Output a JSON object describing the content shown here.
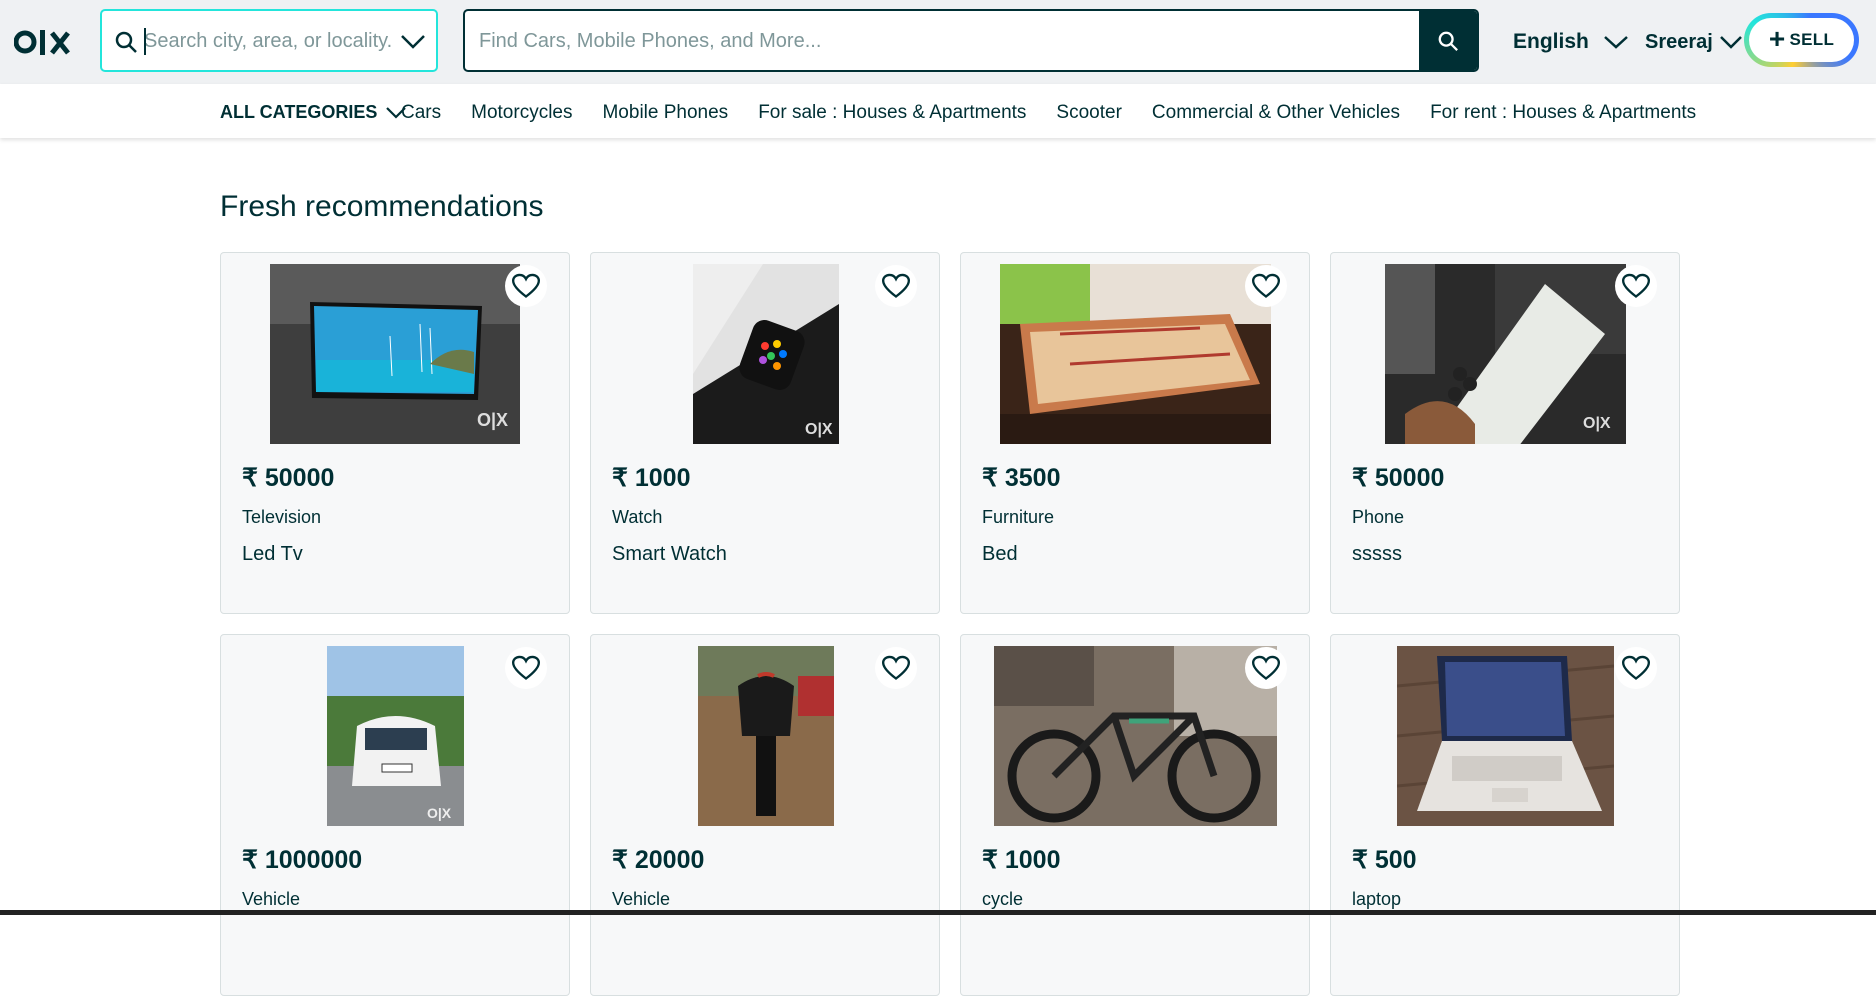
{
  "header": {
    "logo_text": "olx",
    "location_placeholder": "Search city, area, or locality...",
    "search_placeholder": "Find Cars, Mobile Phones, and More...",
    "language": "English",
    "user_name": "Sreeraj",
    "sell_label": "SELL"
  },
  "categories": {
    "all_label": "ALL CATEGORIES",
    "links": [
      "Cars",
      "Motorcycles",
      "Mobile Phones",
      "For sale : Houses & Apartments",
      "Scooter",
      "Commercial & Other Vehicles",
      "For rent : Houses & Apartments"
    ]
  },
  "section": {
    "title": "Fresh recommendations"
  },
  "listings": [
    {
      "price": "₹ 50000",
      "category": "Television",
      "title": "Led Tv"
    },
    {
      "price": "₹ 1000",
      "category": "Watch",
      "title": "Smart Watch"
    },
    {
      "price": "₹ 3500",
      "category": "Furniture",
      "title": "Bed"
    },
    {
      "price": "₹ 50000",
      "category": "Phone",
      "title": "sssss"
    },
    {
      "price": "₹ 1000000",
      "category": "Vehicle",
      "title": ""
    },
    {
      "price": "₹ 20000",
      "category": "Vehicle",
      "title": ""
    },
    {
      "price": "₹ 1000",
      "category": "cycle",
      "title": ""
    },
    {
      "price": "₹ 500",
      "category": "laptop",
      "title": ""
    }
  ],
  "colors": {
    "brand_dark": "#002f34",
    "accent_teal": "#23e5db",
    "header_bg": "#eff1f3"
  }
}
